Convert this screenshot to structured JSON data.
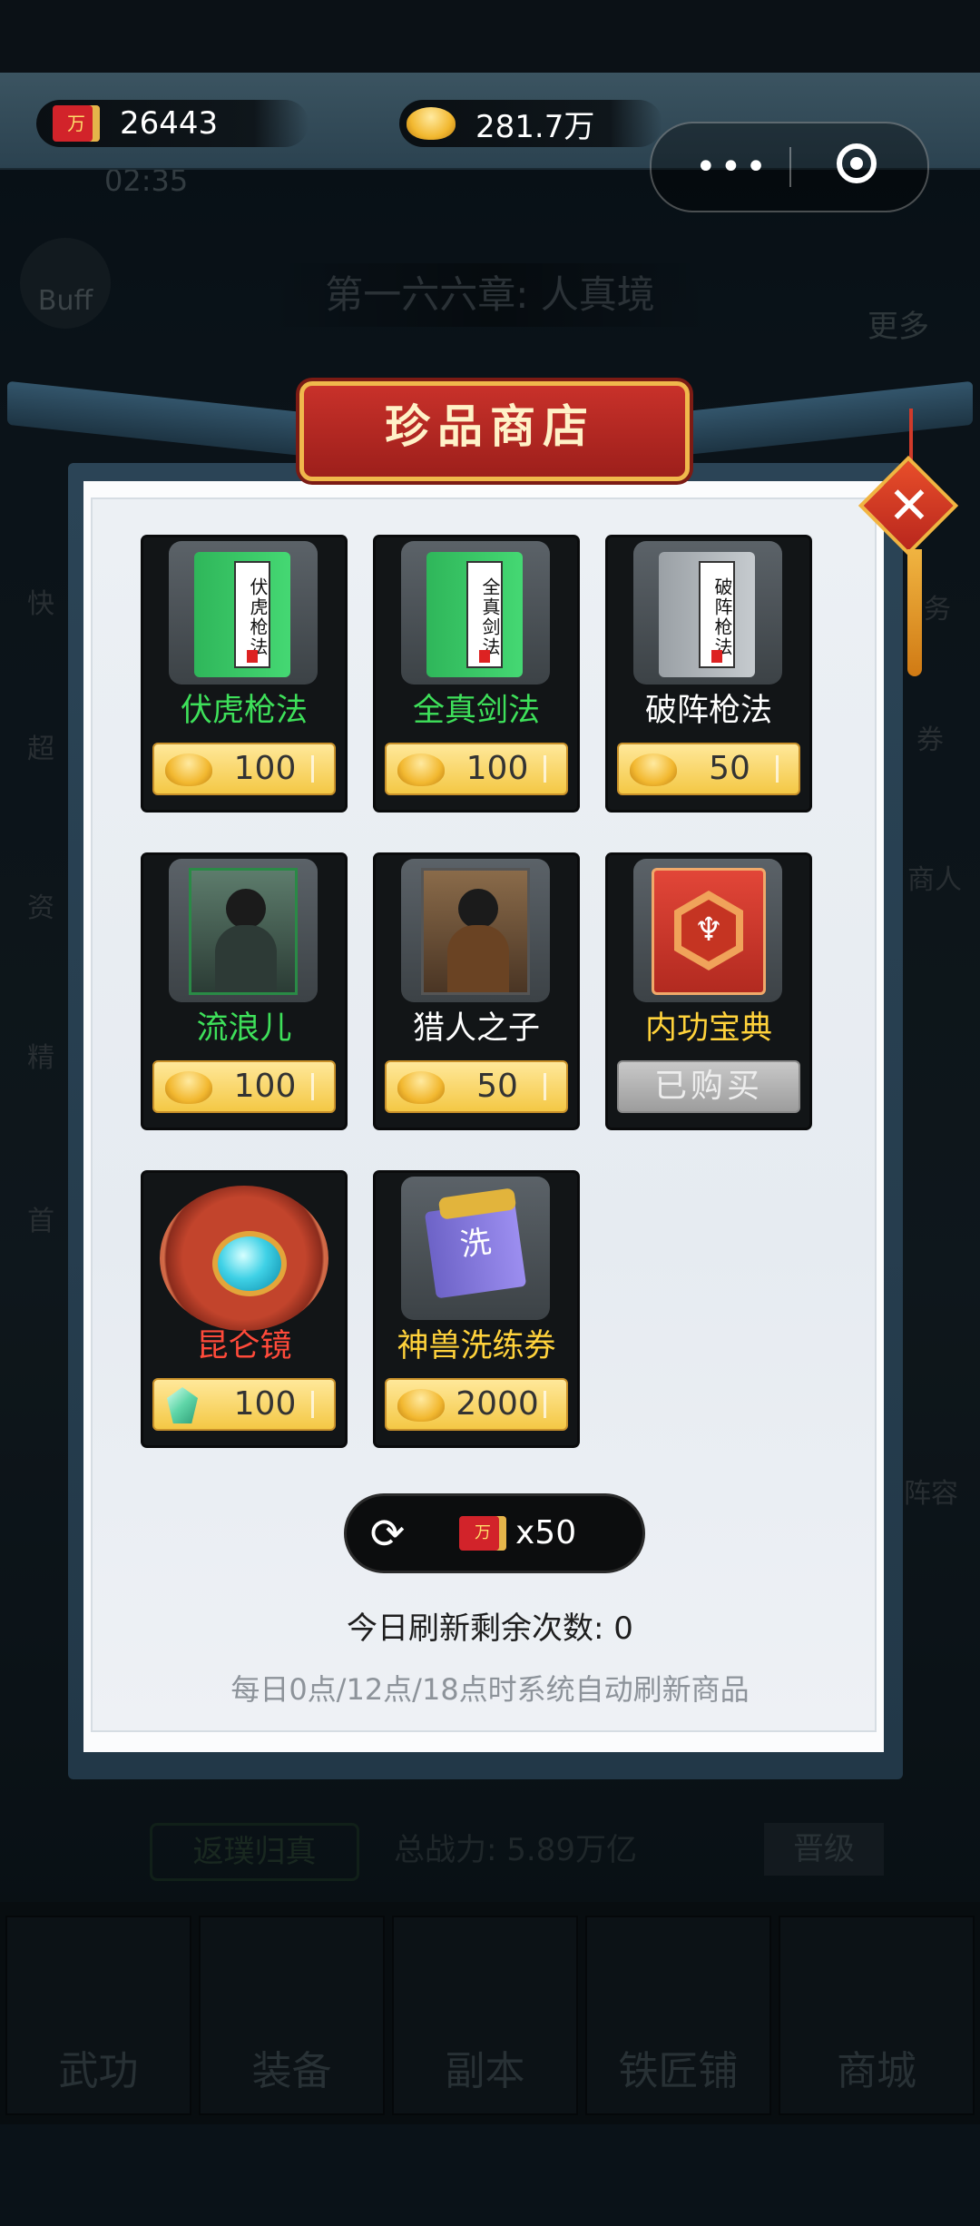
{
  "header": {
    "flag_char": "万",
    "tokens": "26443",
    "gold": "281.7万",
    "timer": "02:35"
  },
  "background": {
    "buff": "Buff",
    "chapter": "第一六六章: 人真境",
    "more": "更多",
    "side_left": [
      "快",
      "超",
      "资",
      "精",
      "首"
    ],
    "side_right": [
      "务",
      "券",
      "商人",
      "阵容"
    ],
    "return_btn": "返璞归真",
    "power": "总战力: 5.89万亿",
    "promote": "晋级",
    "nav": [
      "武功",
      "装备",
      "副本",
      "铁匠铺",
      "商城"
    ]
  },
  "shop": {
    "title": "珍品商店",
    "items": [
      {
        "name": "伏虎枪法",
        "book_title": "伏虎枪法",
        "price": "100",
        "currency": "gold-ingot-icon",
        "rarity": "green"
      },
      {
        "name": "全真剑法",
        "book_title": "全真剑法",
        "price": "100",
        "currency": "gold-ingot-icon",
        "rarity": "green"
      },
      {
        "name": "破阵枪法",
        "book_title": "破阵枪法",
        "price": "50",
        "currency": "gold-ingot-icon",
        "rarity": "white"
      },
      {
        "name": "流浪儿",
        "price": "100",
        "currency": "gold-ingot-icon",
        "rarity": "green"
      },
      {
        "name": "猎人之子",
        "price": "50",
        "currency": "gold-ingot-icon",
        "rarity": "white"
      },
      {
        "name": "内功宝典",
        "price": "已购买",
        "currency": "",
        "rarity": "yellow",
        "purchased": true
      },
      {
        "name": "昆仑镜",
        "price": "100",
        "currency": "jade-gem-icon",
        "rarity": "red"
      },
      {
        "name": "神兽洗练券",
        "scroll_char": "洗",
        "price": "2000",
        "currency": "gold-ingot-icon",
        "rarity": "yellow"
      }
    ],
    "refresh_cost": "x50",
    "remaining": "今日刷新剩余次数: 0",
    "hint": "每日0点/12点/18点时系统自动刷新商品"
  },
  "colors": {
    "green": "#3ee05a",
    "white": "#ffffff",
    "yellow": "#ffd23b",
    "red": "#ff4a3a",
    "title_red": "#c8312a",
    "price_gold": "#f4c845"
  }
}
